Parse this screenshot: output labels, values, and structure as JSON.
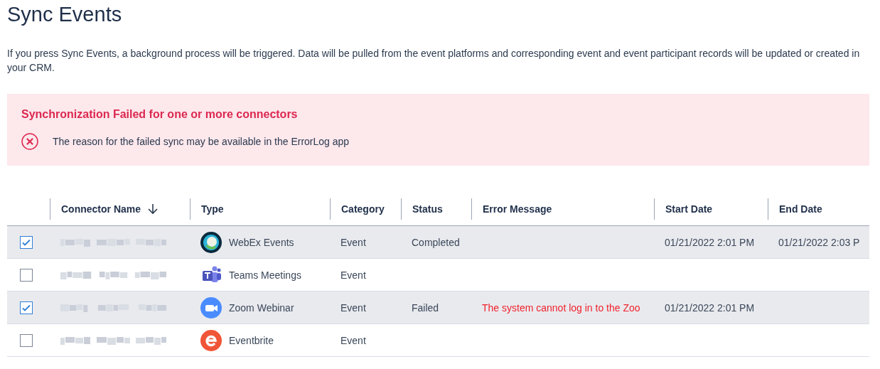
{
  "page": {
    "title": "Sync Events",
    "description": "If you press Sync Events, a background process will be triggered. Data will be pulled from the event platforms and corresponding event and event participant records will be updated or created in your CRM."
  },
  "alert": {
    "title": "Synchronization Failed for one or more connectors",
    "message": "The reason for the failed sync may be available in the ErrorLog app"
  },
  "table": {
    "columns": [
      {
        "label": "Connector Name",
        "sorted": true
      },
      {
        "label": "Type",
        "sorted": false
      },
      {
        "label": "Category",
        "sorted": false
      },
      {
        "label": "Status",
        "sorted": false
      },
      {
        "label": "Error Message",
        "sorted": false
      },
      {
        "label": "Start Date",
        "sorted": false
      },
      {
        "label": "End Date",
        "sorted": false
      }
    ],
    "rows": [
      {
        "selected": true,
        "name_blurred": true,
        "kind": "webex",
        "type": "WebEx Events",
        "category": "Event",
        "status": "Completed",
        "error": "",
        "start": "01/21/2022 2:01 PM",
        "end": "01/21/2022 2:03 P"
      },
      {
        "selected": false,
        "name_blurred": true,
        "kind": "teams",
        "type": "Teams Meetings",
        "category": "Event",
        "status": "",
        "error": "",
        "start": "",
        "end": ""
      },
      {
        "selected": true,
        "name_blurred": true,
        "kind": "zoom",
        "type": "Zoom Webinar",
        "category": "Event",
        "status": "Failed",
        "error": "The system cannot log in to the Zoo",
        "start": "01/21/2022 2:01 PM",
        "end": ""
      },
      {
        "selected": false,
        "name_blurred": true,
        "kind": "eventbrite",
        "type": "Eventbrite",
        "category": "Event",
        "status": "",
        "error": "",
        "start": "",
        "end": ""
      }
    ]
  }
}
